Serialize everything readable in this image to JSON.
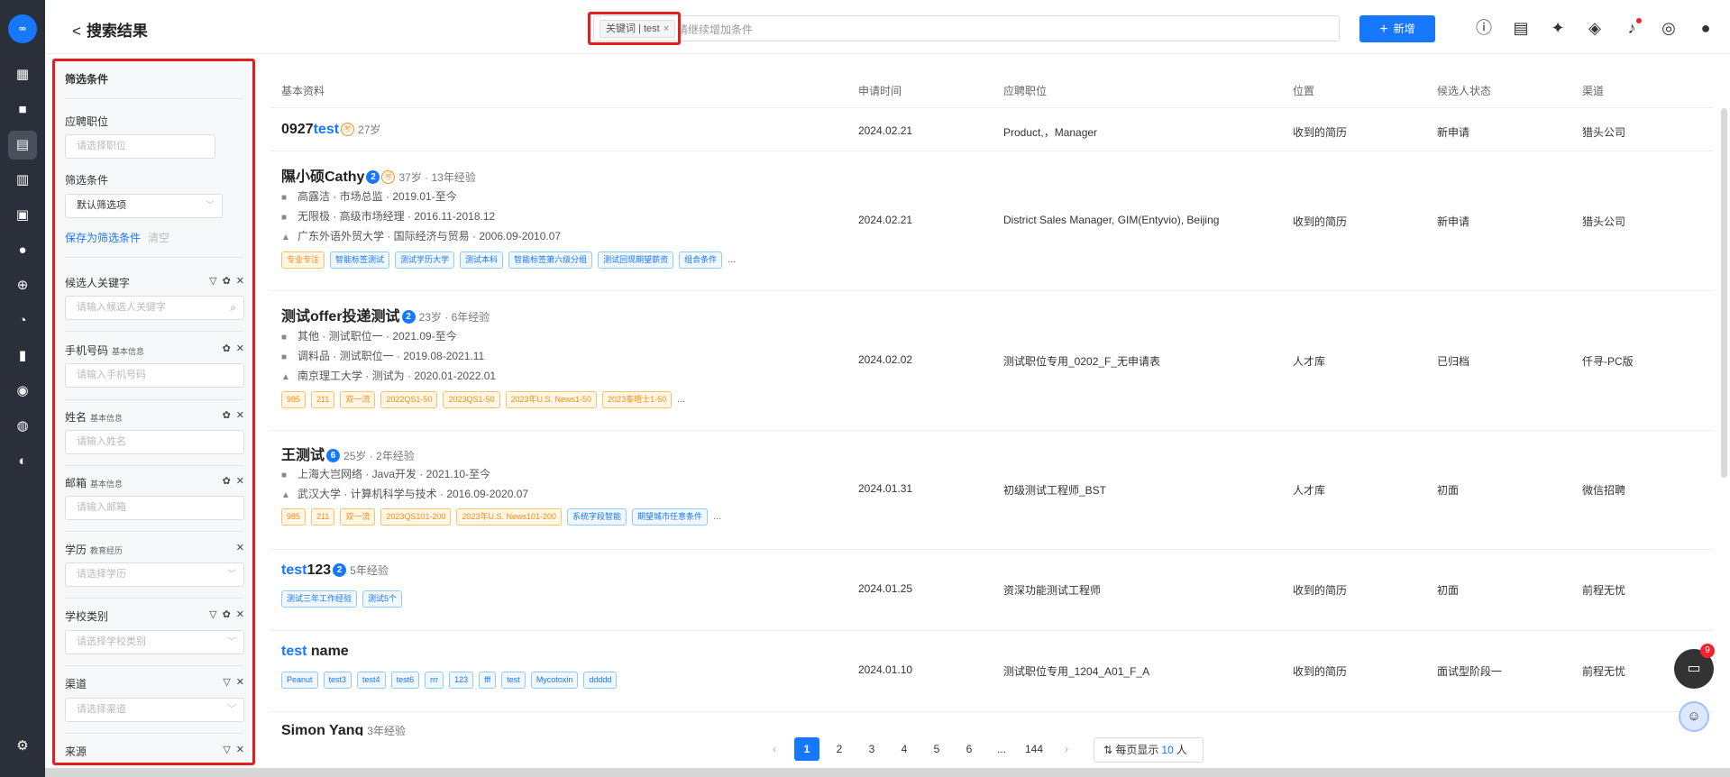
{
  "nav": {
    "logo_text": "∞",
    "icons": [
      "dashboard-icon",
      "briefcase-icon",
      "resume-search-icon",
      "calendar-icon",
      "id-card-icon",
      "chat-icon",
      "add-circle-icon",
      "pie-chart-icon",
      "bar-chart-icon",
      "person-badge-icon",
      "team-icon",
      "user-group-icon",
      "settings-icon"
    ]
  },
  "header": {
    "title": "搜索结果",
    "search_tag": "关键词 | test",
    "search_tag_close": "×",
    "search_placeholder": "请继续增加条件",
    "new_button": "新增"
  },
  "filter": {
    "title": "筛选条件",
    "job_label": "应聘职位",
    "job_placeholder": "请选择职位",
    "criteria_label": "筛选条件",
    "criteria_value": "默认筛选项",
    "save_link": "保存为筛选条件",
    "clear_link": "清空",
    "keyword_label": "候选人关键字",
    "keyword_placeholder": "请输入候选人关键字",
    "phone_label": "手机号码",
    "phone_sub": "基本信息",
    "phone_placeholder": "请输入手机号码",
    "name_label": "姓名",
    "name_sub": "基本信息",
    "name_placeholder": "请输入姓名",
    "email_label": "邮箱",
    "email_sub": "基本信息",
    "email_placeholder": "请输入邮箱",
    "edu_label": "学历",
    "edu_sub": "教育经历",
    "edu_placeholder": "请选择学历",
    "school_label": "学校类别",
    "school_placeholder": "请选择学校类别",
    "channel_label": "渠道",
    "channel_placeholder": "请选择渠道",
    "source_label": "来源"
  },
  "table": {
    "headers": {
      "basic": "基本资料",
      "date": "申请时间",
      "position": "应聘职位",
      "location": "位置",
      "status": "候选人状态",
      "channel": "渠道"
    },
    "rows": [
      {
        "name_pre": "0927",
        "name_hl": "test",
        "name_post": "",
        "badge_o": "㊢",
        "meta": "27岁",
        "date": "2024.02.21",
        "position": "Product,，Manager",
        "location": "收到的简历",
        "status": "新申请",
        "channel": "猎头公司"
      },
      {
        "name": "隰小硕Cathy",
        "badge_b": "2",
        "badge_o": "㊢",
        "meta": "37岁 · 13年经验",
        "exp": [
          "高露洁 · 市场总监 · 2019.01-至今",
          "无限极 · 高级市场经理 · 2016.11-2018.12",
          "广东外语外贸大学 · 国际经济与贸易 · 2006.09-2010.07"
        ],
        "tags": [
          "专业专注",
          "智能标签测试",
          "测试学历大学",
          "测试本科",
          "智能标签第六级分组",
          "测试回现期望薪资",
          "组合条件"
        ],
        "more": "...",
        "date": "2024.02.21",
        "position": "District Sales Manager, GIM(Entyvio), Beijing",
        "location": "收到的简历",
        "status": "新申请",
        "channel": "猎头公司"
      },
      {
        "name": "测试offer投递测试",
        "badge_b": "2",
        "meta": "23岁 · 6年经验",
        "exp": [
          "其他 · 测试职位一 · 2021.09-至今",
          "调料品 · 测试职位一 · 2019.08-2021.11",
          "南京理工大学 · 测试为 · 2020.01-2022.01"
        ],
        "tags": [
          "985",
          "211",
          "双一流",
          "2022QS1-50",
          "2023QS1-50",
          "2023年U.S. News1-50",
          "2023泰晤士1-50"
        ],
        "more": "...",
        "date": "2024.02.02",
        "position": "测试职位专用_0202_F_无申请表",
        "location": "人才库",
        "status": "已归档",
        "channel": "仟寻-PC版"
      },
      {
        "name": "王测试",
        "badge_b": "6",
        "meta": "25岁 · 2年经验",
        "exp": [
          "上海大岂网络 · Java开发 · 2021.10-至今",
          "武汉大学 · 计算机科学与技术 · 2016.09-2020.07"
        ],
        "tags": [
          "985",
          "211",
          "双一流",
          "2023QS101-200",
          "2023年U.S. News101-200",
          "系统字段智能",
          "期望城市任意条件"
        ],
        "more": "...",
        "date": "2024.01.31",
        "position": "初级测试工程师_BST",
        "location": "人才库",
        "status": "初面",
        "channel": "微信招聘"
      },
      {
        "name_hl": "test",
        "name_post": "123",
        "badge_b": "2",
        "meta": "5年经验",
        "tags": [
          "测试三年工作经验",
          "测试5个"
        ],
        "date": "2024.01.25",
        "position": "资深功能测试工程师",
        "location": "收到的简历",
        "status": "初面",
        "channel": "前程无忧"
      },
      {
        "name_hl": "test",
        "name_post": " name",
        "tags": [
          "Peanut",
          "test3",
          "test4",
          "test6",
          "rrr",
          "123",
          "fff",
          "test",
          "Mycotoxin",
          "ddddd"
        ],
        "date": "2024.01.10",
        "position": "测试职位专用_1204_A01_F_A",
        "location": "收到的简历",
        "status": "面试型阶段一",
        "channel": "前程无忧"
      },
      {
        "name": "Simon Yang",
        "meta": "3年经验"
      }
    ]
  },
  "pagination": {
    "prev": "‹",
    "pages": [
      "1",
      "2",
      "3",
      "4",
      "5",
      "6"
    ],
    "ellipsis": "...",
    "last": "144",
    "next": "›",
    "size_pre": "每页显示",
    "size_num": "10",
    "size_post": "人"
  },
  "chat": {
    "badge": "9"
  },
  "colors": {
    "primary": "#1677ff",
    "highlight_border": "#e02020",
    "rail": "#2b2f3a"
  }
}
